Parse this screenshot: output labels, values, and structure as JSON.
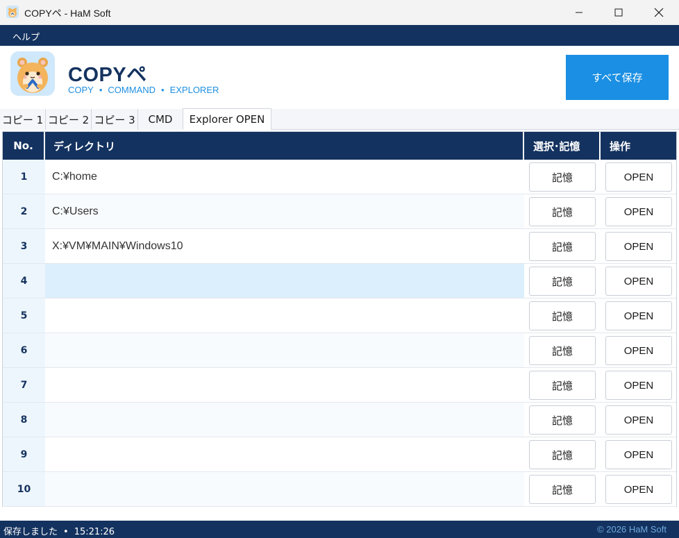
{
  "window": {
    "title": "COPYペ - HaM Soft"
  },
  "menu": {
    "items": [
      {
        "label": "ヘルプ"
      }
    ]
  },
  "header": {
    "brand": "COPYペ",
    "sub_copy": "COPY",
    "sub_command": "COMMAND",
    "sub_explorer": "EXPLORER",
    "sub_dot": "•",
    "save_all": "すべて保存"
  },
  "tabs": [
    {
      "label": "コピー 1",
      "active": false
    },
    {
      "label": "コピー 2",
      "active": false
    },
    {
      "label": "コピー 3",
      "active": false
    },
    {
      "label": "CMD",
      "active": false
    },
    {
      "label": "Explorer OPEN",
      "active": true
    }
  ],
  "grid": {
    "headers": {
      "no": "No.",
      "dir": "ディレクトリ",
      "select": "選択･記憶",
      "action": "操作"
    },
    "rows": [
      {
        "no": "1",
        "dir": "C:¥home",
        "mem": "記憶",
        "open": "OPEN"
      },
      {
        "no": "2",
        "dir": "C:¥Users",
        "mem": "記憶",
        "open": "OPEN"
      },
      {
        "no": "3",
        "dir": "X:¥VM¥MAIN¥Windows10",
        "mem": "記憶",
        "open": "OPEN"
      },
      {
        "no": "4",
        "dir": "",
        "mem": "記憶",
        "open": "OPEN"
      },
      {
        "no": "5",
        "dir": "",
        "mem": "記憶",
        "open": "OPEN"
      },
      {
        "no": "6",
        "dir": "",
        "mem": "記憶",
        "open": "OPEN"
      },
      {
        "no": "7",
        "dir": "",
        "mem": "記憶",
        "open": "OPEN"
      },
      {
        "no": "8",
        "dir": "",
        "mem": "記憶",
        "open": "OPEN"
      },
      {
        "no": "9",
        "dir": "",
        "mem": "記憶",
        "open": "OPEN"
      },
      {
        "no": "10",
        "dir": "",
        "mem": "記憶",
        "open": "OPEN"
      }
    ],
    "selected_row": "4"
  },
  "status": {
    "message": "保存しました",
    "sep": "•",
    "time": "15:21:26",
    "copyright": "© 2026  HaM Soft"
  },
  "colors": {
    "navy": "#14325f",
    "accent": "#1a8fe3",
    "selected_row": "#dbeffc"
  },
  "icons": {
    "app": "hamster-app-icon",
    "minimize": "minimize-icon",
    "maximize": "maximize-icon",
    "close": "close-icon"
  }
}
